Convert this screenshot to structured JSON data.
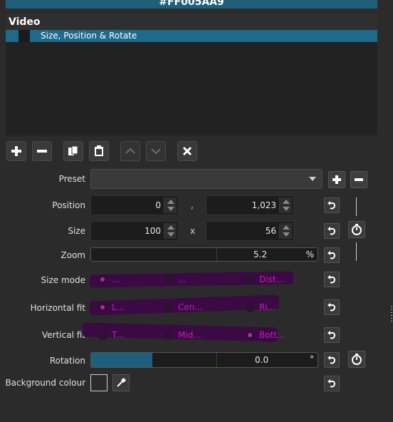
{
  "header": {
    "color_code": "#FF005AA9"
  },
  "filter_list": {
    "title": "Video",
    "items": [
      {
        "label": "Size, Position & Rotate",
        "selected": true
      }
    ]
  },
  "toolbar": {
    "buttons": [
      {
        "name": "add-filter-button",
        "icon": "plus-icon",
        "enabled": true
      },
      {
        "name": "remove-filter-button",
        "icon": "minus-icon",
        "enabled": true
      },
      {
        "name": "copy-filter-button",
        "icon": "copy-icon",
        "enabled": true
      },
      {
        "name": "paste-filter-button",
        "icon": "paste-icon",
        "enabled": true
      },
      {
        "name": "move-up-button",
        "icon": "chevron-up-icon",
        "enabled": false
      },
      {
        "name": "move-down-button",
        "icon": "chevron-down-icon",
        "enabled": false
      },
      {
        "name": "deselect-button",
        "icon": "close-icon",
        "enabled": true
      }
    ]
  },
  "properties": {
    "preset": {
      "label": "Preset",
      "value": ""
    },
    "position": {
      "label": "Position",
      "x": "0",
      "separator": ",",
      "y": "1,023"
    },
    "size": {
      "label": "Size",
      "width": "100",
      "separator": "x",
      "height": "56"
    },
    "zoom": {
      "label": "Zoom",
      "value": "5.2",
      "unit": "%"
    },
    "size_mode": {
      "label": "Size mode",
      "options": [
        {
          "label": "...",
          "checked": true
        },
        {
          "label": "...",
          "checked": false
        },
        {
          "label": "Dist...",
          "checked": false
        }
      ]
    },
    "horizontal_fit": {
      "label": "Horizontal fit",
      "options": [
        {
          "label": "L...",
          "checked": true
        },
        {
          "label": "Cen...",
          "checked": false
        },
        {
          "label": "Ri...",
          "checked": false
        }
      ]
    },
    "vertical_fit": {
      "label": "Vertical fit",
      "options": [
        {
          "label": "T...",
          "checked": false
        },
        {
          "label": "Mid...",
          "checked": false
        },
        {
          "label": "Bott...",
          "checked": true
        }
      ]
    },
    "rotation": {
      "label": "Rotation",
      "value": "0.0",
      "unit": "°",
      "fill_fraction": 0.27
    },
    "background_colour": {
      "label": "Background colour",
      "value": "#2b2b2b"
    }
  },
  "colors": {
    "accent": "#1d6a8b",
    "header_bar": "#1f5f7a",
    "radio_accent": "#c01db8",
    "slider_fill": "#1e5f7e"
  }
}
